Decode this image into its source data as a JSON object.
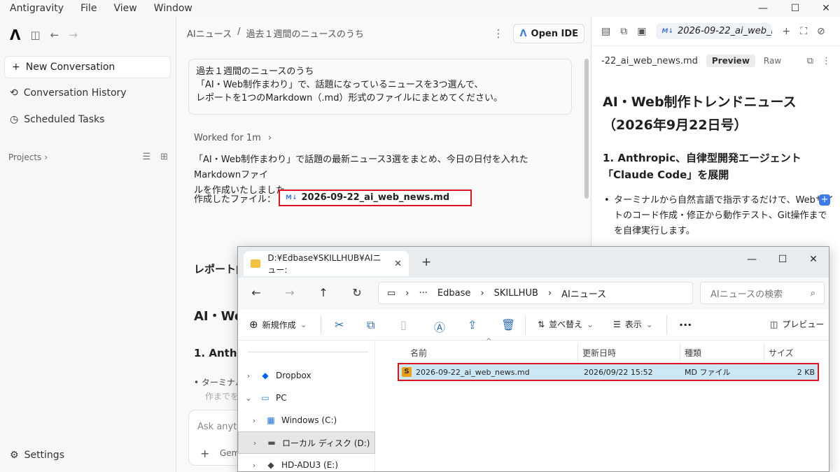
{
  "menubar": {
    "items": [
      "Antigravity",
      "File",
      "View",
      "Window"
    ]
  },
  "sidebar": {
    "new_conversation": "New Conversation",
    "items": [
      "Conversation History",
      "Scheduled Tasks"
    ],
    "projects_label": "Projects",
    "settings_label": "Settings"
  },
  "chat": {
    "breadcrumb": [
      "AIニュース",
      "/",
      "過去１週間のニュースのうち"
    ],
    "open_ide": "Open IDE",
    "prompt_lines": [
      "過去１週間のニュースのうち",
      "「AI・Web制作まわり」で、話題になっているニュースを3つ選んで、",
      "レポートを1つのMarkdown（.md）形式のファイルにまとめてください。"
    ],
    "worked_for": "Worked for 1m",
    "reply_lines": [
      "「AI・Web制作まわり」で話題の最新ニュース3選をまとめ、今日の日付を入れたMarkdownファイ",
      "ルを作成いたしました。"
    ],
    "created_file_label": "作成したファイル：",
    "created_file_name": "2026-09-22_ai_web_news.md",
    "md_badge": "M↓",
    "report_heading_partial": "レポート内",
    "h1_partial": "AI・We",
    "h2_partial": "1. Anthro",
    "li_partial": "ターミナル",
    "li_partial2": "作までを",
    "ask_placeholder": "Ask anyth",
    "model_partial": "Gem"
  },
  "preview": {
    "tab_title": "2026-09-22_ai_web_n",
    "sub_filename": "-22_ai_web_news.md",
    "mode_preview": "Preview",
    "mode_raw": "Raw",
    "h1": "AI・Web制作トレンドニュース（2026年9月22日号）",
    "h2": "1. Anthropic、自律型開発エージェント「Claude Code」を展開",
    "li": "ターミナルから自然言語で指示するだけで、Webサイトのコード作成・修正から動作テスト、Git操作までを自律実行します。"
  },
  "explorer": {
    "tab_title": "D:¥Edbase¥SKILLHUB¥AIニュー:",
    "path": [
      "Edbase",
      "SKILLHUB",
      "AIニュース"
    ],
    "search_placeholder": "AIニュースの検索",
    "cmd_new": "新規作成",
    "cmd_sort": "並べ替え",
    "cmd_view": "表示",
    "cmd_preview": "プレビュー",
    "nav": [
      "Dropbox",
      "PC",
      "Windows (C:)",
      "ローカル ディスク (D:)",
      "HD-ADU3 (E:)"
    ],
    "columns": [
      "名前",
      "更新日時",
      "種類",
      "サイズ"
    ],
    "file": {
      "name": "2026-09-22_ai_web_news.md",
      "date": "2026/09/22 15:52",
      "type": "MD ファイル",
      "size": "2 KB"
    }
  }
}
